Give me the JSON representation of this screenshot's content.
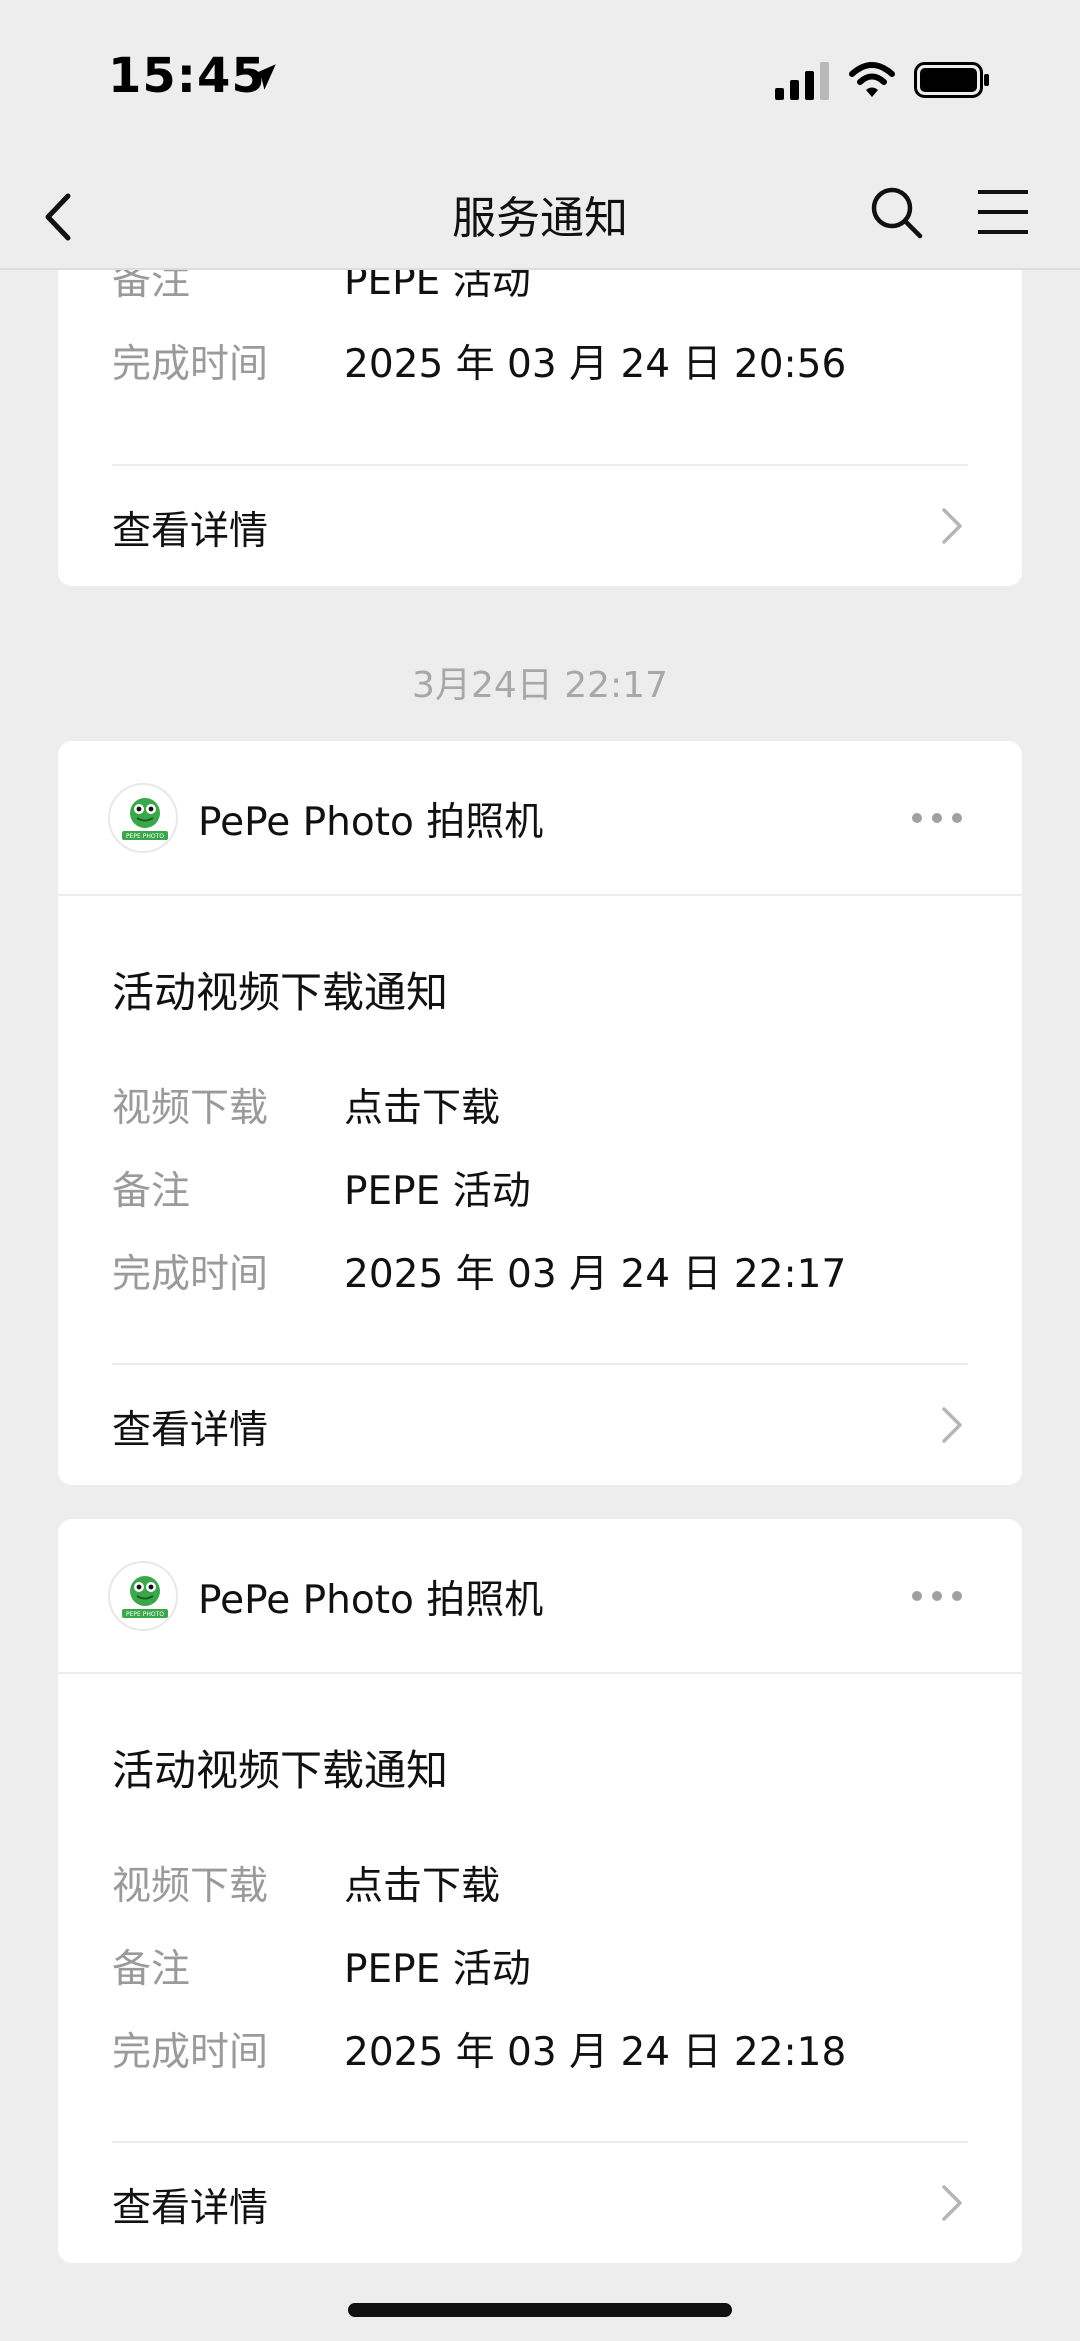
{
  "status_bar": {
    "time": "15:45"
  },
  "nav": {
    "title": "服务通知"
  },
  "prev_card": {
    "fields": [
      {
        "label": "备注",
        "value": "PEPE 活动"
      },
      {
        "label": "完成时间",
        "value": "2025 年 03 月 24 日  20:56"
      }
    ],
    "detail_label": "查看详情"
  },
  "timestamp": "3月24日 22:17",
  "cards": [
    {
      "app_name": "PePe Photo 拍照机",
      "title": "活动视频下载通知",
      "fields": [
        {
          "label": "视频下载",
          "value": "点击下载"
        },
        {
          "label": "备注",
          "value": "PEPE 活动"
        },
        {
          "label": "完成时间",
          "value": "2025 年 03 月 24 日  22:17"
        }
      ],
      "detail_label": "查看详情"
    },
    {
      "app_name": "PePe Photo 拍照机",
      "title": "活动视频下载通知",
      "fields": [
        {
          "label": "视频下载",
          "value": "点击下载"
        },
        {
          "label": "备注",
          "value": "PEPE 活动"
        },
        {
          "label": "完成时间",
          "value": "2025 年 03 月 24 日  22:18"
        }
      ],
      "detail_label": "查看详情"
    }
  ],
  "avatar_logo_text": "PEPE PHOTO",
  "colors": {
    "background": "#ededed",
    "card": "#ffffff",
    "label_gray": "#9a9a9a",
    "avatar_green": "#3aa84a"
  }
}
